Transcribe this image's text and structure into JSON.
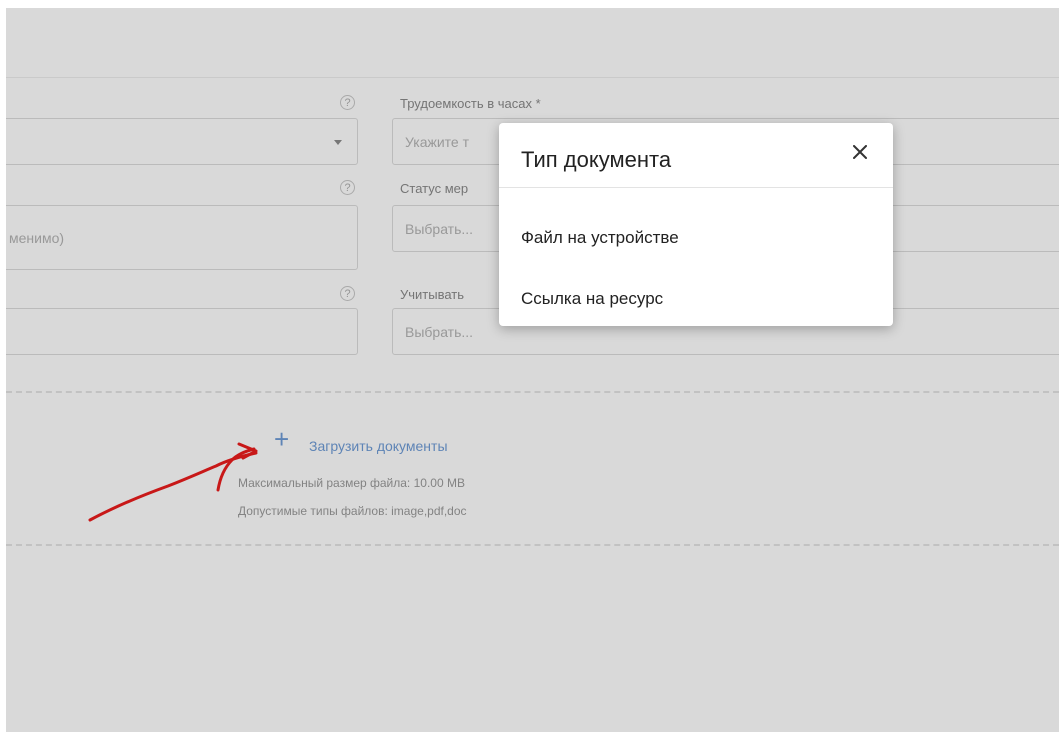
{
  "form": {
    "labor_label": "Трудоемкость в часах *",
    "labor_placeholder": "Укажите т",
    "status_label": "Статус мер",
    "status_placeholder": "Выбрать...",
    "left_field_text": "менимо)",
    "consider_label": "Учитывать",
    "consider_placeholder": "Выбрать...",
    "help_glyph": "?"
  },
  "upload": {
    "plus": "+",
    "link_label": "Загрузить документы",
    "max_size": "Максимальный размер файла: 10.00 MB",
    "allowed_types": "Допустимые типы файлов: image,pdf,doc"
  },
  "dialog": {
    "title": "Тип документа",
    "close_icon": "close-icon",
    "options": [
      {
        "label": "Файл на устройстве"
      },
      {
        "label": "Ссылка на ресурс"
      }
    ]
  },
  "colors": {
    "link": "#6f9cd6",
    "annotation": "#c81818",
    "overlay": "rgba(0,0,0,0.15)"
  }
}
